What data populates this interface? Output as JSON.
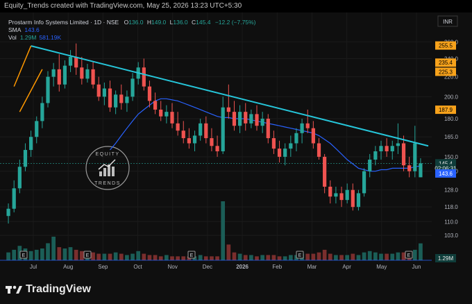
{
  "header": {
    "title": "Equity_Trends created with TradingView.com, May 25, 2026 13:23 UTC+5:30"
  },
  "legend": {
    "symbol": "Prostarm Info Systems Limited · 1D · NSE",
    "o_label": "O",
    "o": "136.0",
    "h_label": "H",
    "h": "149.0",
    "l_label": "L",
    "l": "136.0",
    "c_label": "C",
    "c": "145.4",
    "change": "−12.2 (−7.75%)",
    "sma_label": "SMA",
    "sma": "143.6",
    "vol_label": "Vol",
    "vol": "1.29M",
    "vol_ma": "581.19K"
  },
  "currency": "INR",
  "watermark": {
    "line1": "EQUITY",
    "line2": "TRENDS"
  },
  "footer": {
    "brand": "TradingView"
  },
  "colors": {
    "up": "#26a69a",
    "down": "#ef5350",
    "sma": "#2962ff",
    "trendline": "#26c6da",
    "channel": "#ff9800",
    "price_tag": "#f7a21b"
  },
  "chart_data": {
    "type": "candlestick",
    "y_scale": "log",
    "ylim": [
      100,
      262
    ],
    "y_ticks": [
      103.0,
      110.0,
      118.0,
      128.0,
      140.0,
      150.0,
      165.0,
      180.0,
      200.0,
      220.0,
      240.0,
      260.0
    ],
    "x_tick_labels": [
      "Jul",
      "Aug",
      "Sep",
      "Oct",
      "Nov",
      "Dec",
      "2026",
      "Feb",
      "Mar",
      "Apr",
      "May",
      "Jun"
    ],
    "price_tags": [
      {
        "value": "255.5",
        "level": 255.5,
        "style": "orange"
      },
      {
        "value": "235.4",
        "level": 235.4,
        "style": "orange"
      },
      {
        "value": "225.3",
        "level": 225.3,
        "style": "orange"
      },
      {
        "value": "187.9",
        "level": 187.9,
        "style": "orange"
      },
      {
        "value": "145.4",
        "level": 145.4,
        "style": "close"
      },
      {
        "value": "02:06:31",
        "level": 142.0,
        "style": "close"
      },
      {
        "value": "143.6",
        "level": 138.5,
        "style": "sma"
      }
    ],
    "volume_tag": "1.29M",
    "earnings_marks": [
      "E",
      "E",
      "E",
      "E",
      "E"
    ],
    "series": [
      {
        "type": "candlestick",
        "values": [
          [
            113,
            120,
            109,
            117
          ],
          [
            117,
            134,
            115,
            129
          ],
          [
            129,
            148,
            126,
            143
          ],
          [
            143,
            160,
            140,
            155
          ],
          [
            155,
            170,
            150,
            165
          ],
          [
            165,
            182,
            160,
            178
          ],
          [
            178,
            200,
            172,
            194
          ],
          [
            194,
            226,
            190,
            220
          ],
          [
            220,
            235,
            210,
            228
          ],
          [
            228,
            245,
            205,
            212
          ],
          [
            212,
            238,
            208,
            232
          ],
          [
            232,
            250,
            225,
            242
          ],
          [
            242,
            258,
            222,
            230
          ],
          [
            230,
            242,
            212,
            218
          ],
          [
            218,
            234,
            214,
            228
          ],
          [
            228,
            236,
            208,
            212
          ],
          [
            212,
            220,
            196,
            200
          ],
          [
            200,
            214,
            192,
            208
          ],
          [
            208,
            216,
            186,
            190
          ],
          [
            190,
            206,
            184,
            202
          ],
          [
            202,
            212,
            188,
            194
          ],
          [
            194,
            206,
            186,
            200
          ],
          [
            200,
            224,
            196,
            218
          ],
          [
            218,
            236,
            212,
            230
          ],
          [
            230,
            240,
            206,
            210
          ],
          [
            210,
            216,
            190,
            196
          ],
          [
            196,
            204,
            184,
            188
          ],
          [
            188,
            196,
            178,
            182
          ],
          [
            182,
            192,
            176,
            186
          ],
          [
            186,
            194,
            172,
            176
          ],
          [
            176,
            186,
            166,
            170
          ],
          [
            170,
            178,
            160,
            164
          ],
          [
            164,
            172,
            156,
            160
          ],
          [
            160,
            170,
            154,
            166
          ],
          [
            166,
            180,
            162,
            176
          ],
          [
            176,
            182,
            160,
            164
          ],
          [
            164,
            172,
            154,
            158
          ],
          [
            158,
            166,
            150,
            154
          ],
          [
            154,
            200,
            152,
            190
          ],
          [
            190,
            212,
            180,
            186
          ],
          [
            186,
            196,
            170,
            174
          ],
          [
            174,
            192,
            168,
            186
          ],
          [
            186,
            194,
            170,
            176
          ],
          [
            176,
            188,
            172,
            184
          ],
          [
            184,
            192,
            170,
            174
          ],
          [
            174,
            186,
            168,
            180
          ],
          [
            180,
            184,
            160,
            164
          ],
          [
            164,
            170,
            152,
            156
          ],
          [
            156,
            162,
            146,
            150
          ],
          [
            150,
            160,
            144,
            156
          ],
          [
            156,
            166,
            150,
            160
          ],
          [
            160,
            172,
            154,
            168
          ],
          [
            168,
            180,
            160,
            176
          ],
          [
            176,
            188,
            168,
            172
          ],
          [
            172,
            178,
            156,
            160
          ],
          [
            160,
            164,
            148,
            150
          ],
          [
            150,
            152,
            126,
            130
          ],
          [
            130,
            134,
            120,
            124
          ],
          [
            124,
            130,
            120,
            126
          ],
          [
            126,
            130,
            118,
            122
          ],
          [
            122,
            132,
            120,
            128
          ],
          [
            128,
            132,
            116,
            118
          ],
          [
            118,
            128,
            116,
            126
          ],
          [
            126,
            142,
            124,
            140
          ],
          [
            140,
            152,
            136,
            148
          ],
          [
            148,
            158,
            144,
            154
          ],
          [
            154,
            162,
            148,
            158
          ],
          [
            158,
            164,
            150,
            154
          ],
          [
            154,
            162,
            148,
            158
          ],
          [
            158,
            176,
            152,
            160
          ],
          [
            160,
            166,
            140,
            144
          ],
          [
            144,
            150,
            136,
            140
          ],
          [
            140,
            174,
            136,
            160
          ],
          [
            136,
            149,
            136,
            145.4
          ]
        ]
      },
      {
        "type": "line",
        "name": "SMA",
        "values": [
          null,
          null,
          null,
          null,
          null,
          null,
          null,
          null,
          null,
          null,
          null,
          null,
          null,
          null,
          null,
          null,
          null,
          null,
          155,
          160,
          166,
          172,
          178,
          184,
          188,
          192,
          196,
          198,
          198,
          197,
          196,
          194,
          192,
          190,
          188,
          186,
          184,
          182,
          181,
          181,
          180,
          180,
          180,
          179,
          178,
          177,
          176,
          175,
          174,
          173,
          172,
          171,
          170,
          169,
          168,
          166,
          163,
          160,
          156,
          152,
          148,
          145,
          142,
          141,
          140,
          140,
          141,
          141,
          142,
          142,
          142,
          142,
          143,
          143.6
        ]
      },
      {
        "type": "volume",
        "name": "Vol",
        "values": [
          0.6,
          0.8,
          1.1,
          0.9,
          0.7,
          0.8,
          0.9,
          1.3,
          1.8,
          1.0,
          0.9,
          1.0,
          0.8,
          0.7,
          0.6,
          0.6,
          0.5,
          0.5,
          0.5,
          0.6,
          0.5,
          0.4,
          0.5,
          0.7,
          0.5,
          0.4,
          0.4,
          0.3,
          0.4,
          0.3,
          0.3,
          0.3,
          0.3,
          0.3,
          0.4,
          0.3,
          0.3,
          0.3,
          4.5,
          1.2,
          0.6,
          0.5,
          0.4,
          0.4,
          0.3,
          0.4,
          0.4,
          0.4,
          0.3,
          0.3,
          0.4,
          0.4,
          0.5,
          0.5,
          0.5,
          0.6,
          0.8,
          0.5,
          0.4,
          0.4,
          0.4,
          0.5,
          0.4,
          0.6,
          0.7,
          0.6,
          0.5,
          0.5,
          0.5,
          0.6,
          0.6,
          0.5,
          0.8,
          1.29
        ]
      }
    ],
    "annotations": [
      {
        "type": "trendline",
        "from": [
          4,
          255
        ],
        "to": [
          73,
          158
        ]
      },
      {
        "type": "channel_upper",
        "from": [
          1,
          210
        ],
        "to": [
          4,
          255
        ]
      },
      {
        "type": "channel_lower",
        "from": [
          2,
          186
        ],
        "to": [
          6,
          228
        ]
      }
    ]
  }
}
